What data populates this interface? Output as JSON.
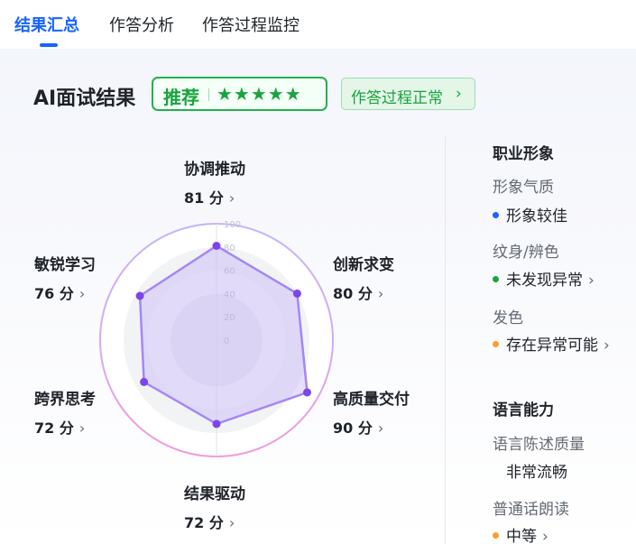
{
  "tabs": [
    {
      "label": "结果汇总"
    },
    {
      "label": "作答分析"
    },
    {
      "label": "作答过程监控"
    }
  ],
  "result": {
    "title": "AI面试结果",
    "badge_label": "推荐",
    "stars": "★★★★★",
    "rating": 5,
    "status_label": "作答过程正常",
    "chevron": "›"
  },
  "radar": {
    "ticks": [
      "100",
      "80",
      "60",
      "40",
      "20",
      "0"
    ],
    "dimensions": [
      {
        "name": "协调推动",
        "score": 81,
        "score_text": "81 分"
      },
      {
        "name": "创新求变",
        "score": 80,
        "score_text": "80 分"
      },
      {
        "name": "高质量交付",
        "score": 90,
        "score_text": "90 分"
      },
      {
        "name": "结果驱动",
        "score": 72,
        "score_text": "72 分"
      },
      {
        "name": "跨界思考",
        "score": 72,
        "score_text": "72 分"
      },
      {
        "name": "敏锐学习",
        "score": 76,
        "score_text": "76 分"
      }
    ],
    "colors": {
      "line": "#a586f5",
      "fill": "#b9a2f8",
      "point": "#7c45ea"
    }
  },
  "side": {
    "professional_image": {
      "heading": "职业形象",
      "temperament_label": "形象气质",
      "temperament_value": "形象较佳",
      "temperament_color": "#1664ff",
      "tattoo_label": "纹身/辨色",
      "tattoo_value": "未发现异常",
      "tattoo_color": "#1aa33f",
      "hair_label": "发色",
      "hair_value": "存在异常可能",
      "hair_color": "#ff9a2e"
    },
    "language": {
      "heading": "语言能力",
      "quality_label": "语言陈述质量",
      "quality_value": "非常流畅",
      "mandarin_label": "普通话朗读",
      "mandarin_value": "中等",
      "mandarin_color": "#ff9a2e"
    }
  }
}
